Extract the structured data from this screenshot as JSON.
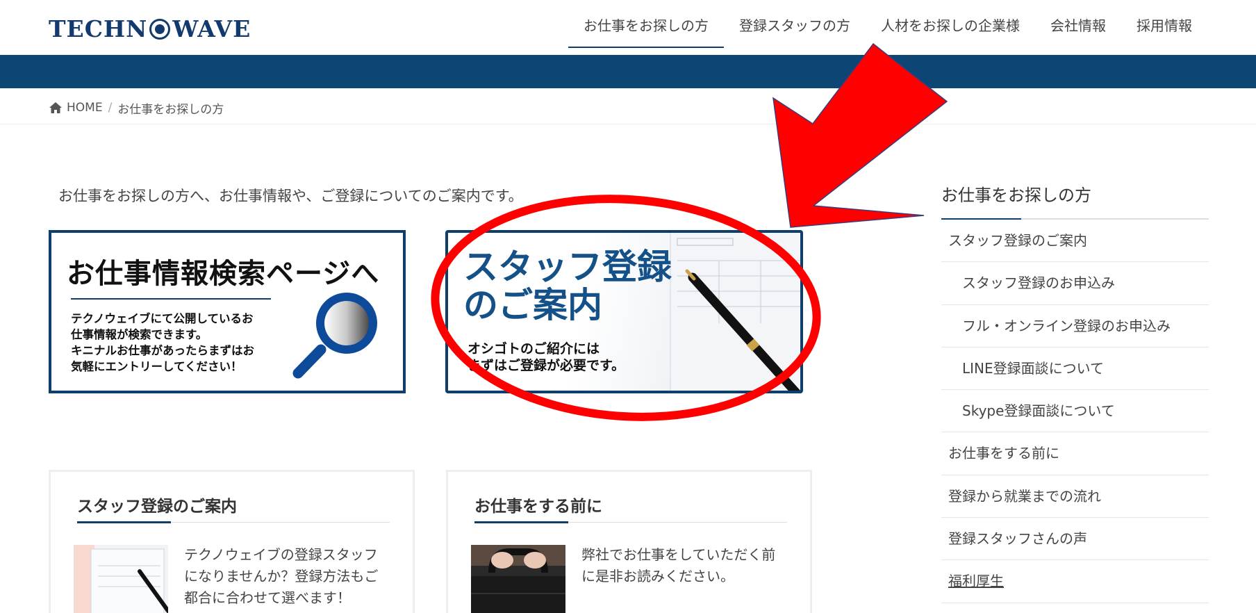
{
  "header": {
    "logo_text_left": "TECHN",
    "logo_text_right": "WAVE",
    "nav": [
      {
        "label": "お仕事をお探しの方",
        "active": true
      },
      {
        "label": "登録スタッフの方",
        "active": false
      },
      {
        "label": "人材をお探しの企業様",
        "active": false
      },
      {
        "label": "会社情報",
        "active": false
      },
      {
        "label": "採用情報",
        "active": false
      }
    ]
  },
  "breadcrumb": {
    "home": "HOME",
    "separator": "/",
    "current": "お仕事をお探しの方"
  },
  "intro": "お仕事をお探しの方へ、お仕事情報や、ご登録についてのご案内です。",
  "banners": {
    "search": {
      "title": "お仕事情報検索ページへ",
      "text": "テクノウェイブにて公開しているお\n仕事情報が検索できます。\nキニナルお仕事があったらまずはお\n気軽にエントリーしてください！",
      "icon": "magnifier-icon"
    },
    "staff": {
      "title": "スタッフ登録\nのご案内",
      "text": "オシゴトのご紹介には\nまずはご登録が必要です。"
    }
  },
  "cards": [
    {
      "title": "スタッフ登録のご案内",
      "text": "テクノウェイブの登録スタッフになりませんか？登録方法もご都合に合わせて選べます！"
    },
    {
      "title": "お仕事をする前に",
      "text": "弊社でお仕事をしていただく前に是非お読みください。"
    }
  ],
  "sidebar": {
    "title": "お仕事をお探しの方",
    "items": [
      {
        "label": "スタッフ登録のご案内"
      },
      {
        "label": "スタッフ登録のお申込み"
      },
      {
        "label": "フル・オンライン登録のお申込み"
      },
      {
        "label": "LINE登録面談について"
      },
      {
        "label": "Skype登録面談について"
      },
      {
        "label": "お仕事をする前に"
      },
      {
        "label": "登録から就業までの流れ"
      },
      {
        "label": "登録スタッフさんの声"
      },
      {
        "label": "福利厚生"
      }
    ]
  },
  "colors": {
    "brand_navy": "#0e3e6b",
    "band_navy": "#0d4574",
    "staff_title_blue": "#145189",
    "annotation_red": "#ff0000"
  }
}
